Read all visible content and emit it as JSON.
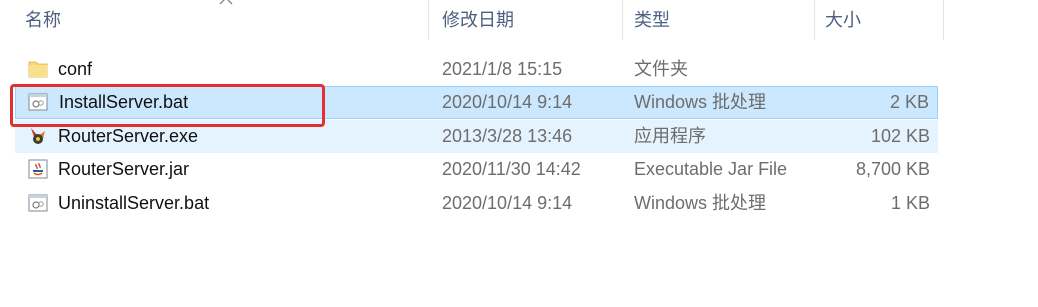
{
  "columns": {
    "name": "名称",
    "date": "修改日期",
    "type": "类型",
    "size": "大小"
  },
  "files": [
    {
      "name": "conf",
      "date": "2021/1/8 15:15",
      "type": "文件夹",
      "size": "",
      "icon": "folder-icon",
      "state": "normal"
    },
    {
      "name": "InstallServer.bat",
      "date": "2020/10/14 9:14",
      "type": "Windows 批处理",
      "size": "2 KB",
      "icon": "batch-file-icon",
      "state": "selected"
    },
    {
      "name": "RouterServer.exe",
      "date": "2013/3/28 13:46",
      "type": "应用程序",
      "size": "102 KB",
      "icon": "executable-icon",
      "state": "hovered"
    },
    {
      "name": "RouterServer.jar",
      "date": "2020/11/30 14:42",
      "type": "Executable Jar File",
      "size": "8,700 KB",
      "icon": "jar-file-icon",
      "state": "normal"
    },
    {
      "name": "UninstallServer.bat",
      "date": "2020/10/14 9:14",
      "type": "Windows 批处理",
      "size": "1 KB",
      "icon": "batch-file-icon",
      "state": "normal"
    }
  ],
  "colors": {
    "selection": "#cce8ff",
    "hover": "#e5f3ff",
    "highlight_box": "#e23030",
    "header_text": "#4d6082"
  }
}
